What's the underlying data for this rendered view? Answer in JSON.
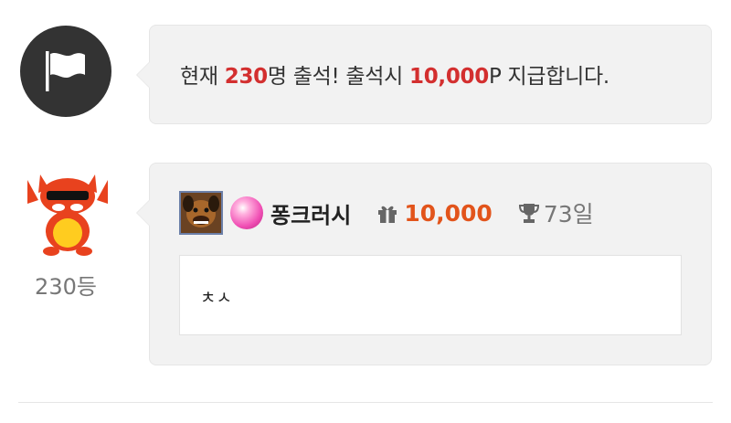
{
  "notice": {
    "prefix": "현재 ",
    "count": "230",
    "middle": "명 출석! 출석시 ",
    "reward": "10,000",
    "suffix": "P 지급합니다.",
    "icon": "flag-icon"
  },
  "entry": {
    "rank_label": "230등",
    "nickname": "퐁크러시",
    "points": "10,000",
    "days": "73일",
    "message": "ㅊㅅ",
    "icons": [
      "user-photo",
      "level-orb-icon",
      "gift-icon",
      "trophy-icon"
    ]
  },
  "colors": {
    "highlight_red": "#d32f2f",
    "points_orange": "#e2541b",
    "bubble_bg": "#f2f2f2",
    "flag_circle": "#333333"
  }
}
